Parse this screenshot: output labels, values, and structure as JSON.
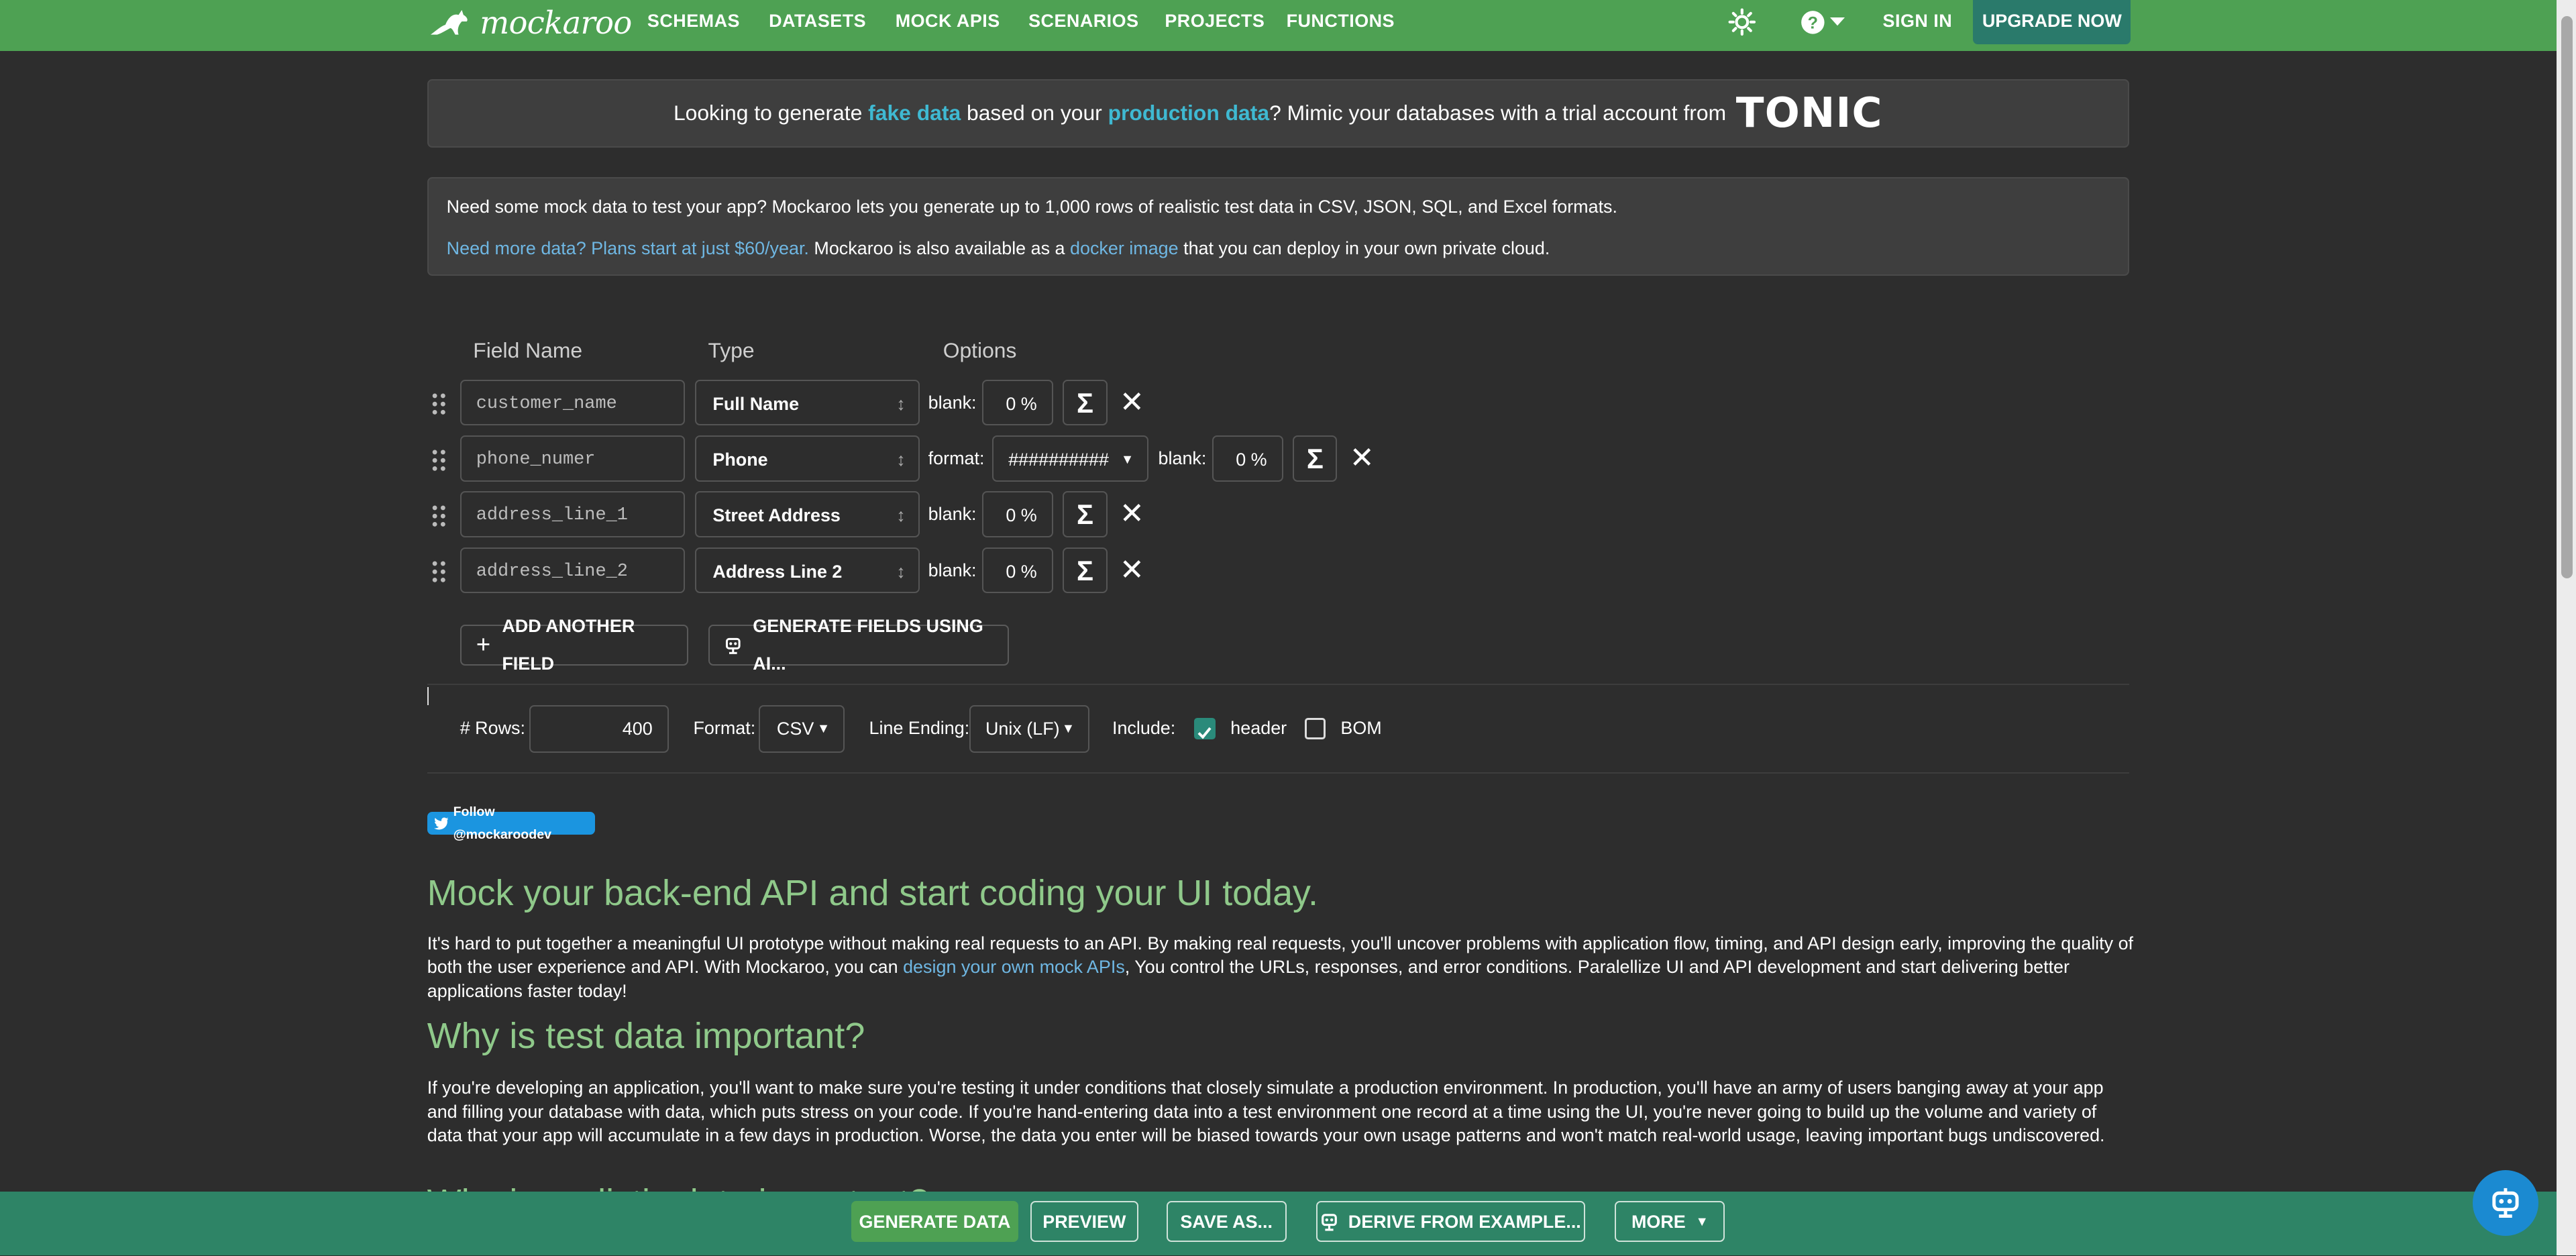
{
  "nav": {
    "logo": "mockaroo",
    "links": [
      "SCHEMAS",
      "DATASETS",
      "MOCK APIS",
      "SCENARIOS",
      "PROJECTS",
      "FUNCTIONS"
    ],
    "sign_in": "SIGN IN",
    "upgrade": "UPGRADE NOW"
  },
  "promo": {
    "pre": "Looking to generate ",
    "hl1": "fake data",
    "mid": " based on your ",
    "hl2": "production data",
    "post": "? Mimic your databases with a trial account from",
    "brand": "TONIC"
  },
  "info": {
    "line1": "Need some mock data to test your app? Mockaroo lets you generate up to 1,000 rows of realistic test data in CSV, JSON, SQL, and Excel formats.",
    "plans_link": "Need more data? Plans start at just $60/year.",
    "line2_mid": " Mockaroo is also available as a ",
    "docker_link": "docker image",
    "line2_end": " that you can deploy in your own private cloud."
  },
  "fields_header": {
    "name": "Field Name",
    "type": "Type",
    "options": "Options"
  },
  "fields": [
    {
      "name": "customer_name",
      "type": "Full Name",
      "blank_label": "blank:",
      "blank": "0 %"
    },
    {
      "name": "phone_numer",
      "type": "Phone",
      "format_label": "format:",
      "format": "##########",
      "blank_label": "blank:",
      "blank": "0 %"
    },
    {
      "name": "address_line_1",
      "type": "Street Address",
      "blank_label": "blank:",
      "blank": "0 %"
    },
    {
      "name": "address_line_2",
      "type": "Address Line 2",
      "blank_label": "blank:",
      "blank": "0 %"
    }
  ],
  "actions": {
    "add_field": "ADD ANOTHER FIELD",
    "generate_ai": "GENERATE FIELDS USING AI..."
  },
  "config": {
    "rows_label": "# Rows:",
    "rows": "400",
    "format_label": "Format:",
    "format": "CSV",
    "line_ending_label": "Line Ending:",
    "line_ending": "Unix (LF)",
    "include_label": "Include:",
    "header_label": "header",
    "header_checked": true,
    "bom_label": "BOM",
    "bom_checked": false
  },
  "follow": "Follow @mockaroodev",
  "sections": {
    "h1": "Mock your back-end API and start coding your UI today.",
    "p1a": "It's hard to put together a meaningful UI prototype without making real requests to an API. By making real requests, you'll uncover problems with application flow, timing, and API design early, improving the quality of both the user experience and API. With Mockaroo, you can ",
    "p1_link": "design your own mock APIs",
    "p1b": ", You control the URLs, responses, and error conditions. Paralellize UI and API development and start delivering better applications faster today!",
    "h2": "Why is test data important?",
    "p2": "If you're developing an application, you'll want to make sure you're testing it under conditions that closely simulate a production environment. In production, you'll have an army of users banging away at your app and filling your database with data, which puts stress on your code. If you're hand-entering data into a test environment one record at a time using the UI, you're never going to build up the volume and variety of data that your app will accumulate in a few days in production. Worse, the data you enter will be biased towards your own usage patterns and won't match real-world usage, leaving important bugs undiscovered.",
    "h3": "Why is realistic data important?"
  },
  "bottom": {
    "generate": "GENERATE DATA",
    "preview": "PREVIEW",
    "save_as": "SAVE AS...",
    "derive": "DERIVE FROM EXAMPLE...",
    "more": "MORE"
  },
  "colors": {
    "brand_green": "#4ea153",
    "bottom_bar": "#2e8466",
    "link": "#6fb7e3",
    "accent_cyan": "#3fb9d2",
    "heading_green": "#8fc98a"
  }
}
